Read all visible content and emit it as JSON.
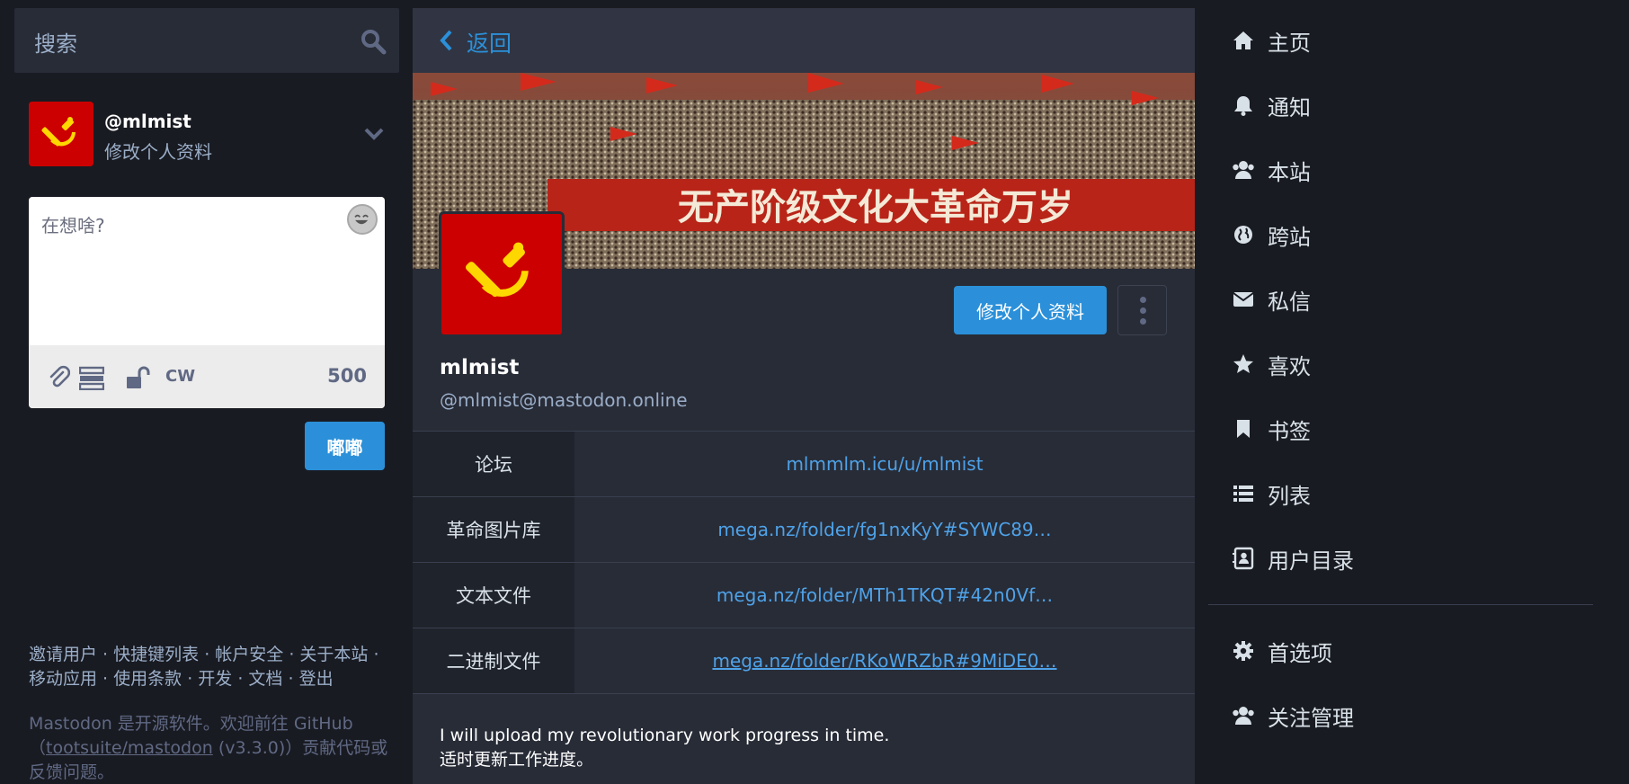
{
  "search": {
    "placeholder": "搜索",
    "icon": "search-icon"
  },
  "account": {
    "handle": "@mlmist",
    "edit_label": "修改个人资料",
    "menu_icon": "chevron-down-icon"
  },
  "compose": {
    "placeholder": "在想啥?",
    "emoji_icon": "emoji-icon",
    "toolbar": {
      "attach_icon": "paperclip-icon",
      "poll_icon": "poll-icon",
      "privacy_icon": "unlock-icon",
      "cw_label": "CW",
      "char_count": "500"
    },
    "submit_label": "嘟嘟"
  },
  "footer": {
    "links_line1": [
      "邀请用户",
      "快捷键列表",
      "帐户安全",
      "关于本站"
    ],
    "links_line2": [
      "移动应用",
      "使用条款",
      "开发",
      "文档",
      "登出"
    ],
    "about_prefix": "Mastodon 是开源软件。欢迎前往 GitHub（",
    "about_link": "tootsuite/mastodon",
    "about_suffix": " (v3.3.0)）贡献代码或反馈问题。"
  },
  "profile": {
    "back_label": "返回",
    "banner_caption": "无产阶级文化大革命万岁",
    "edit_button": "修改个人资料",
    "display_name": "mlmist",
    "username": "@mlmist@mastodon.online",
    "fields": [
      {
        "name": "论坛",
        "value": "mlmmlm.icu/u/mlmist"
      },
      {
        "name": "革命图片库",
        "value": "mega.nz/folder/fg1nxKyY#SYWC89…"
      },
      {
        "name": "文本文件",
        "value": "mega.nz/folder/MTh1TKQT#42n0Vf…"
      },
      {
        "name": "二进制文件",
        "value": "mega.nz/folder/RKoWRZbR#9MiDE0…"
      }
    ],
    "bio_line1": "I will upload my revolutionary work progress in time.",
    "bio_line2": "适时更新工作进度。"
  },
  "nav": {
    "items": [
      {
        "label": "主页",
        "icon": "home-icon"
      },
      {
        "label": "通知",
        "icon": "bell-icon"
      },
      {
        "label": "本站",
        "icon": "users-icon"
      },
      {
        "label": "跨站",
        "icon": "globe-icon"
      },
      {
        "label": "私信",
        "icon": "envelope-icon"
      },
      {
        "label": "喜欢",
        "icon": "star-icon"
      },
      {
        "label": "书签",
        "icon": "bookmark-icon"
      },
      {
        "label": "列表",
        "icon": "list-icon"
      },
      {
        "label": "用户目录",
        "icon": "address-book-icon"
      },
      {
        "label": "首选项",
        "icon": "gear-icon"
      },
      {
        "label": "关注管理",
        "icon": "users-icon"
      }
    ]
  },
  "colors": {
    "background": "#191b22",
    "panel": "#282c37",
    "accent": "#2b90d9",
    "link": "#4ea2e8",
    "flag_red": "#cc0000",
    "flag_yellow": "#ffd700"
  }
}
